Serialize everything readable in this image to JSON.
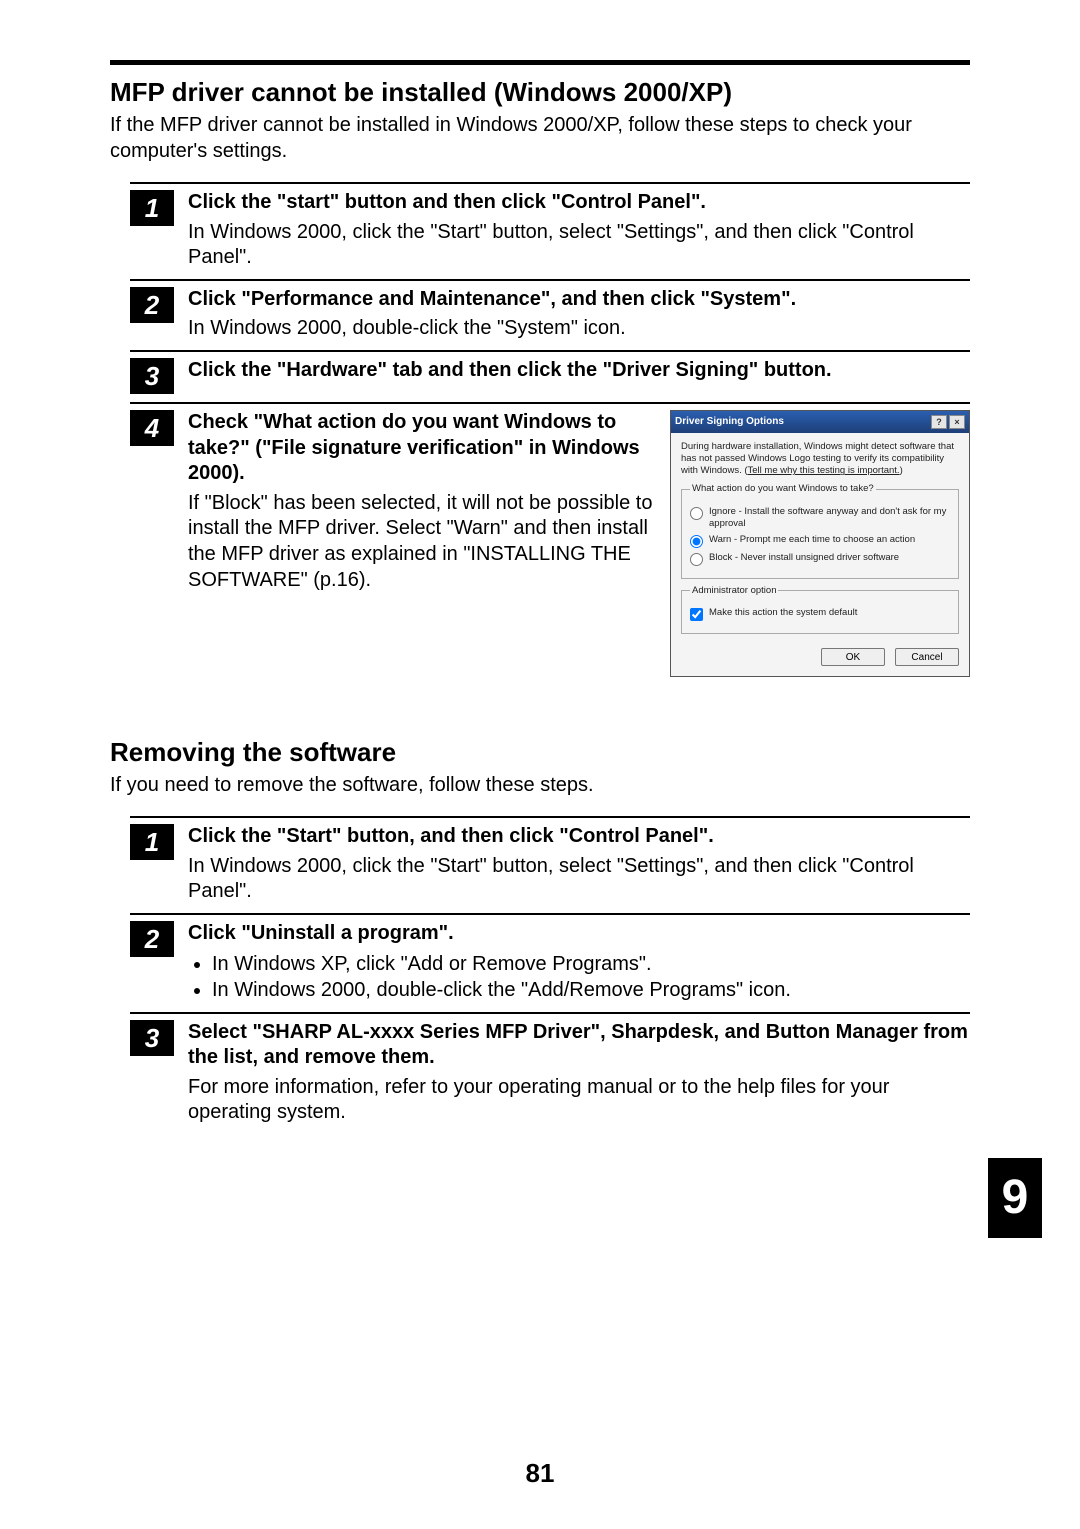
{
  "page_number": "81",
  "chapter_tab": "9",
  "section1": {
    "title": "MFP driver cannot be installed (Windows 2000/XP)",
    "intro": "If the MFP driver cannot be installed in Windows 2000/XP, follow these steps to check your computer's settings.",
    "steps": [
      {
        "num": "1",
        "title": "Click the \"start\" button and then click \"Control Panel\".",
        "desc": "In Windows 2000, click the \"Start\" button, select \"Settings\", and then click \"Control Panel\"."
      },
      {
        "num": "2",
        "title": "Click \"Performance and Maintenance\", and then click \"System\".",
        "desc": "In Windows 2000, double-click the \"System\" icon."
      },
      {
        "num": "3",
        "title": "Click the \"Hardware\" tab and then click the \"Driver Signing\" button.",
        "desc": ""
      },
      {
        "num": "4",
        "title": "Check \"What action do you want Windows to take?\" (\"File signature verification\" in Windows 2000).",
        "desc": "If \"Block\" has been selected, it will not be possible to install the MFP driver. Select \"Warn\" and then install the MFP driver as explained in \"INSTALLING THE SOFTWARE\" (p.16)."
      }
    ]
  },
  "dialog": {
    "title": "Driver Signing Options",
    "help_btn": "?",
    "close_btn": "×",
    "body_text": "During hardware installation, Windows might detect software that has not passed Windows Logo testing to verify its compatibility with Windows. (",
    "body_link": "Tell me why this testing is important.",
    "body_text_end": ")",
    "group1_legend": "What action do you want Windows to take?",
    "opt_ignore": "Ignore - Install the software anyway and don't ask for my approval",
    "opt_warn": "Warn - Prompt me each time to choose an action",
    "opt_block": "Block - Never install unsigned driver software",
    "group2_legend": "Administrator option",
    "check_default": "Make this action the system default",
    "ok": "OK",
    "cancel": "Cancel"
  },
  "section2": {
    "title": "Removing the software",
    "intro": "If you need to remove the software, follow these steps.",
    "steps": [
      {
        "num": "1",
        "title": "Click the \"Start\" button, and then click \"Control Panel\".",
        "desc": "In Windows 2000, click the \"Start\" button, select \"Settings\", and then click \"Control Panel\"."
      },
      {
        "num": "2",
        "title": "Click \"Uninstall a program\".",
        "bullets": [
          "In Windows XP, click \"Add or Remove Programs\".",
          "In Windows 2000, double-click the \"Add/Remove Programs\" icon."
        ]
      },
      {
        "num": "3",
        "title": "Select \"SHARP AL-xxxx Series MFP Driver\", Sharpdesk, and Button Manager from the list, and remove them.",
        "desc": "For more information, refer to your operating manual or to the help files for your operating system."
      }
    ]
  }
}
